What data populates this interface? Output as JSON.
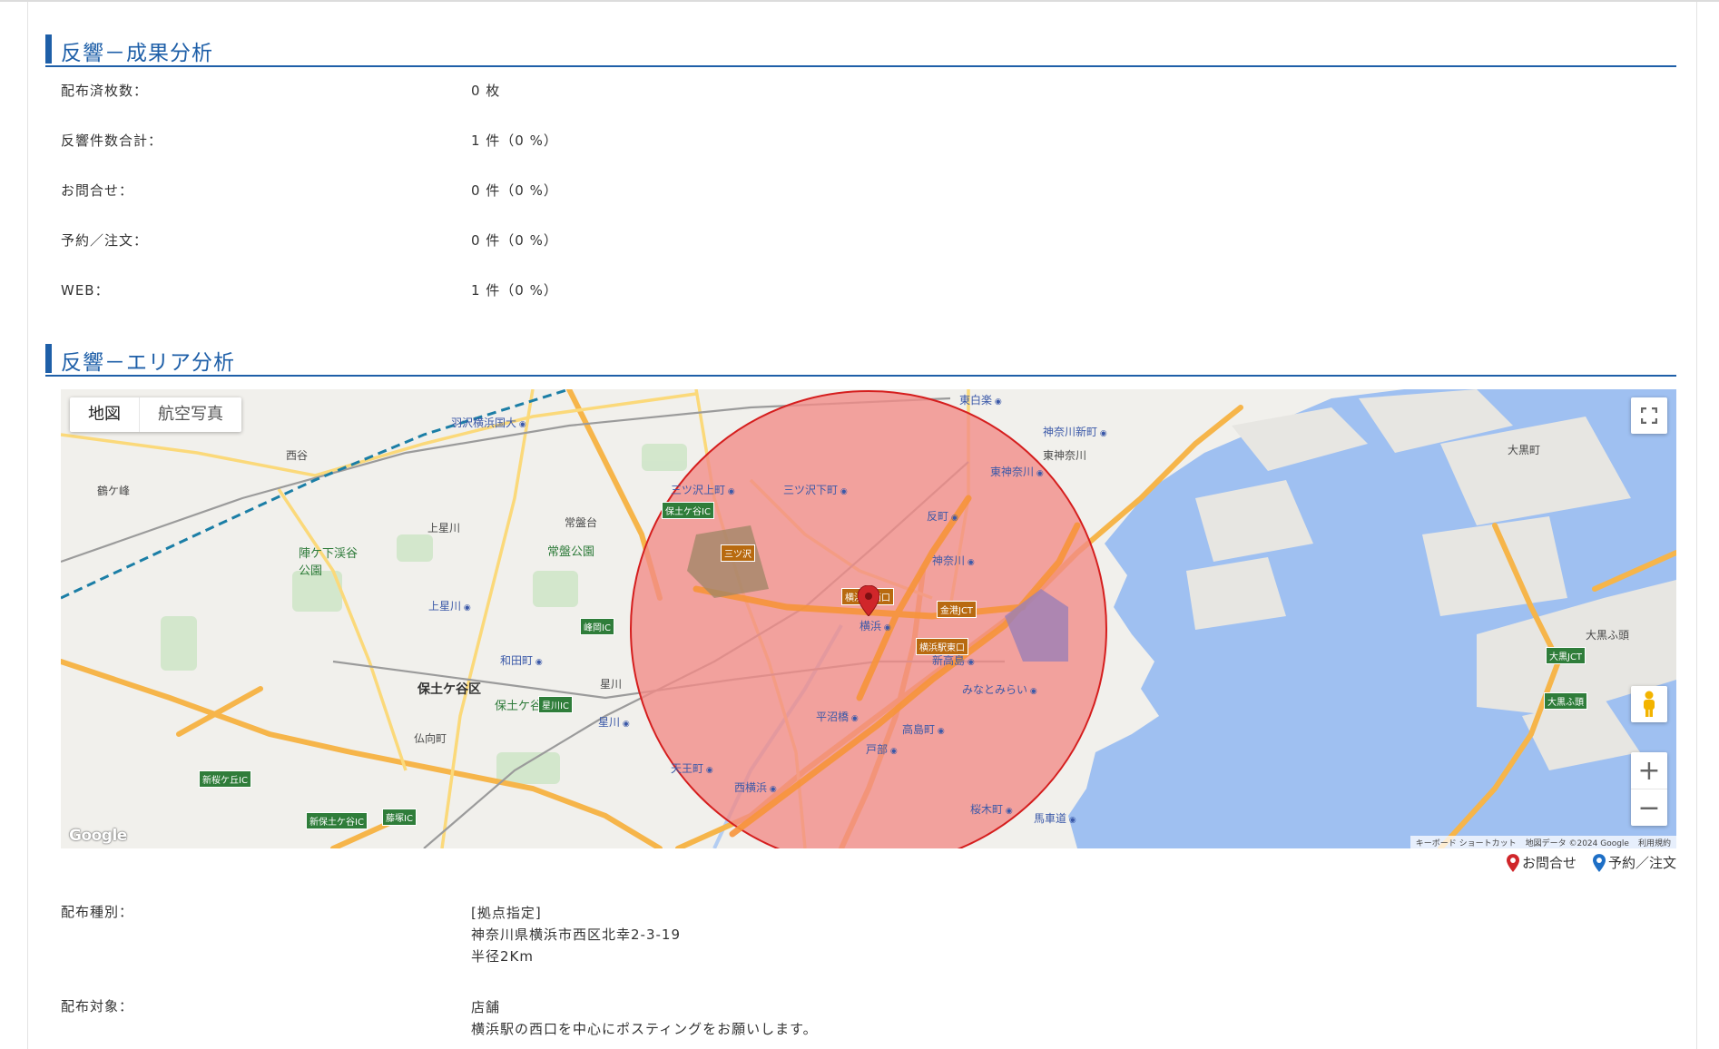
{
  "sections": {
    "results_title": "反響－成果分析",
    "area_title": "反響－エリア分析"
  },
  "results": [
    {
      "label": "配布済枚数：",
      "value": "0 枚"
    },
    {
      "label": "反響件数合計：",
      "value": "1 件（0 %）"
    },
    {
      "label": "お問合せ：",
      "value": "0 件（0 %）"
    },
    {
      "label": "予約／注文：",
      "value": "0 件（0 %）"
    },
    {
      "label": "WEB：",
      "value": "1 件（0 %）"
    }
  ],
  "map": {
    "type_map": "地図",
    "type_aerial": "航空写真",
    "fullscreen_icon": "fullscreen-icon",
    "pegman_icon": "pegman-icon",
    "zoom_in": "+",
    "zoom_out": "−",
    "google": "Google",
    "attribution": {
      "shortcuts": "キーボード ショートカット",
      "data": "地図データ ©2024 Google",
      "terms": "利用規約"
    },
    "circle_color": "#e8484f",
    "marker_color": "#d0262a",
    "labels": {
      "ward": "保土ケ谷区",
      "yokohama": "横浜",
      "minatomirai": "みなとみらい",
      "shin_takashima": "新高島",
      "takashimacho": "高島町",
      "tobe": "戸部",
      "hiranumabashi": "平沼橋",
      "nishiyokohama": "西横浜",
      "tennocho": "天王町",
      "hoshikawa": "星川",
      "wadamachi": "和田町",
      "kamihoshikawa": "上星川",
      "kanagawa": "神奈川",
      "higashi_kanagawa": "東神奈川",
      "naka_kiba": "東神奈川",
      "kanagawa_shinmachi": "神奈川新町",
      "tanmachi": "反町",
      "higashi_hakuraku": "東白楽",
      "mitsuzawa_kamicho": "三ツ沢上町",
      "mitsuzawa_shimocho": "三ツ沢下町",
      "hazawa": "羽沢横浜国大",
      "nishiya": "西谷",
      "tsurugamine": "鶴ケ峰",
      "tokiwadai": "常盤台",
      "tokiwa_park": "常盤公園",
      "jingagashita": "陣ケ下渓谷公園",
      "hodogaya_park": "保土ケ谷公園",
      "kamihoshikawa_area": "上星川",
      "hoshikawa_area": "星川",
      "bukkoucho": "仏向町",
      "daikoku": "大黒町",
      "daikoku_futo": "大黒ふ頭",
      "daikoku_pa": "大黒ふ頭",
      "sakuragicho": "桜木町",
      "bashamichi": "馬車道",
      "ic_hodogaya": "保土ケ谷IC",
      "ic_mitsuzawa": "三ツ沢",
      "ic_minemura": "峰岡IC",
      "ic_hoshikawa": "星川IC",
      "ic_shinsakuragaoka": "新桜ケ丘IC",
      "ic_shinhodogaya": "新保土ケ谷IC",
      "ic_fujizuka": "藤塚IC",
      "jct_kinko": "金港JCT",
      "jct_daikoku": "大黒JCT",
      "ic_yokohama_east": "横浜駅東口",
      "ic_yokohama_west": "横浜駅西口",
      "ic_daikoku_futo": "大黒ふ頭"
    }
  },
  "legend": {
    "inquiry": "お問合せ",
    "inquiry_color": "#d0262a",
    "reserve": "予約／注文",
    "reserve_color": "#1e6fc6"
  },
  "distribution": {
    "type_label": "配布種別：",
    "type_lines": [
      "[拠点指定]",
      "神奈川県横浜市西区北幸2-3-19",
      "半径2Km"
    ],
    "target_label": "配布対象：",
    "target_lines": [
      "店舗",
      "横浜駅の西口を中心にポスティングをお願いします。"
    ]
  }
}
